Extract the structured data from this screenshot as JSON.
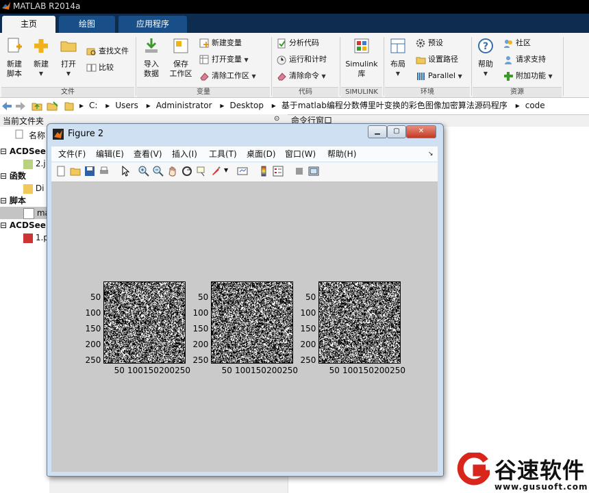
{
  "app": {
    "title": "MATLAB R2014a"
  },
  "tabs": [
    {
      "label": "主页"
    },
    {
      "label": "绘图"
    },
    {
      "label": "应用程序"
    }
  ],
  "ribbon": {
    "file": {
      "new_script": "新建\n脚本",
      "new": "新建",
      "open": "打开",
      "find_files": "查找文件",
      "compare": "比较",
      "group": "文件"
    },
    "variable": {
      "import": "导入\n数据",
      "save_ws": "保存\n工作区",
      "new_var": "新建变量",
      "open_var": "打开变量",
      "clear_ws": "清除工作区",
      "group": "变量"
    },
    "code": {
      "analyze": "分析代码",
      "run_time": "运行和计时",
      "clear_cmd": "清除命令",
      "group": "代码"
    },
    "simulink": {
      "lib": "Simulink\n库",
      "group": "SIMULINK"
    },
    "env": {
      "layout": "布局",
      "prefs": "预设",
      "set_path": "设置路径",
      "parallel": "Parallel",
      "group": "环境"
    },
    "resources": {
      "help": "帮助",
      "community": "社区",
      "support": "请求支持",
      "addons": "附加功能",
      "group": "资源"
    }
  },
  "address": {
    "parts": [
      "C:",
      "Users",
      "Administrator",
      "Desktop",
      "基于matlab编程分数傅里叶变换的彩色图像加密算法源码程序",
      "code"
    ]
  },
  "panel": {
    "current_folder": "当前文件夹",
    "name_col": "名称",
    "command_window": "命令行窗口",
    "items": [
      {
        "label": "ACDSee",
        "kind": "group"
      },
      {
        "label": "2.j",
        "kind": "file"
      },
      {
        "label": "函数",
        "kind": "group"
      },
      {
        "label": "Di",
        "kind": "file"
      },
      {
        "label": "脚本",
        "kind": "group"
      },
      {
        "label": "ma",
        "kind": "file",
        "selected": true
      },
      {
        "label": "ACDSee",
        "kind": "group"
      },
      {
        "label": "1.p",
        "kind": "file"
      }
    ]
  },
  "figure": {
    "title": "Figure 2",
    "menu": [
      "文件(F)",
      "编辑(E)",
      "查看(V)",
      "插入(I)",
      "工具(T)",
      "桌面(D)",
      "窗口(W)",
      "帮助(H)"
    ],
    "axes": {
      "y_ticks": [
        "50",
        "100",
        "150",
        "200",
        "250"
      ],
      "x_ticks": [
        "50",
        "100",
        "150",
        "200",
        "250"
      ],
      "count": 3
    }
  },
  "watermark": {
    "brand": "谷速软件",
    "url": "www.gusuoft.com"
  },
  "colors": {
    "tab_bar": "#0e2c4f",
    "tab_inactive": "#184f88",
    "figure_bg": "#cacaca"
  }
}
